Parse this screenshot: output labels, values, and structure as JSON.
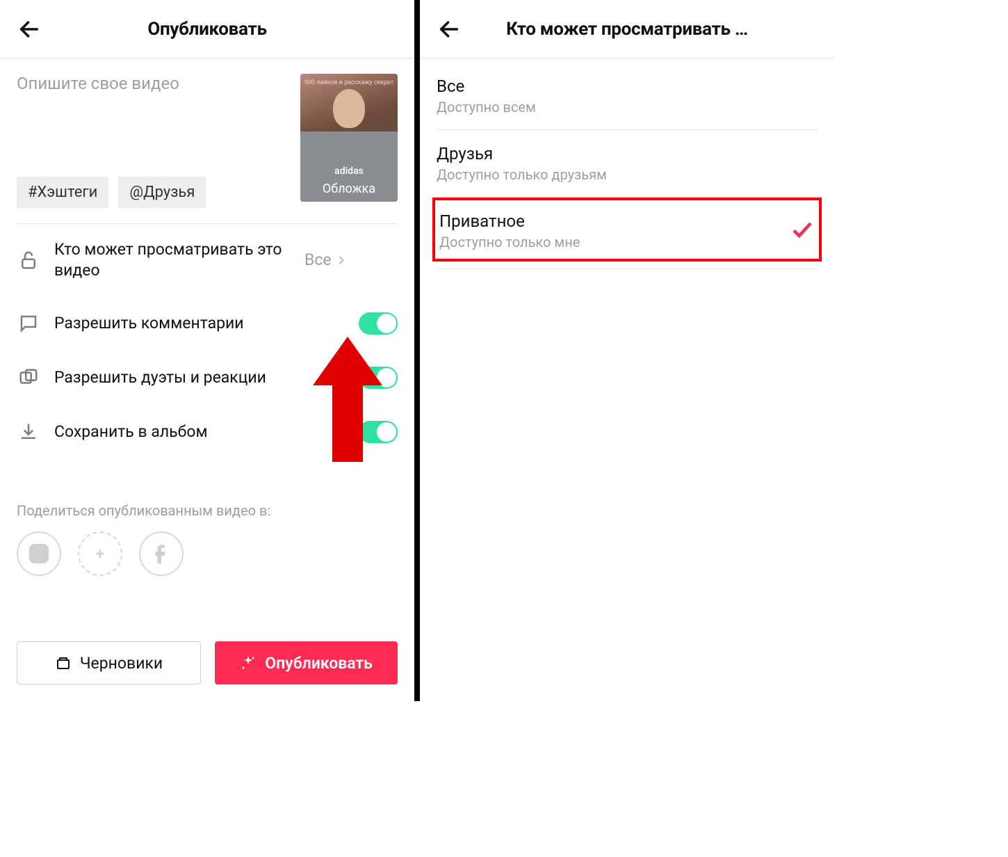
{
  "left": {
    "header_title": "Опубликовать",
    "description_placeholder": "Опишите свое видео",
    "thumbnail": {
      "overlay_text": "500 лайков и расскажу секрет",
      "shirt_brand": "adidas",
      "cover_label": "Обложка"
    },
    "chips": {
      "hashtags": "#Хэштеги",
      "friends": "@Друзья"
    },
    "settings": {
      "privacy": {
        "label": "Кто может просматривать это видео",
        "value": "Все"
      },
      "comments": {
        "label": "Разрешить комментарии"
      },
      "duets": {
        "label": "Разрешить дуэты и реакции"
      },
      "save_album": {
        "label": "Сохранить в альбом"
      }
    },
    "share_label": "Поделиться опубликованным видео в:",
    "footer": {
      "drafts": "Черновики",
      "publish": "Опубликовать"
    }
  },
  "right": {
    "header_title": "Кто может просматривать …",
    "options": [
      {
        "title": "Все",
        "sub": "Доступно всем"
      },
      {
        "title": "Друзья",
        "sub": "Доступно только друзьям"
      },
      {
        "title": "Приватное",
        "sub": "Доступно только мне"
      }
    ]
  }
}
